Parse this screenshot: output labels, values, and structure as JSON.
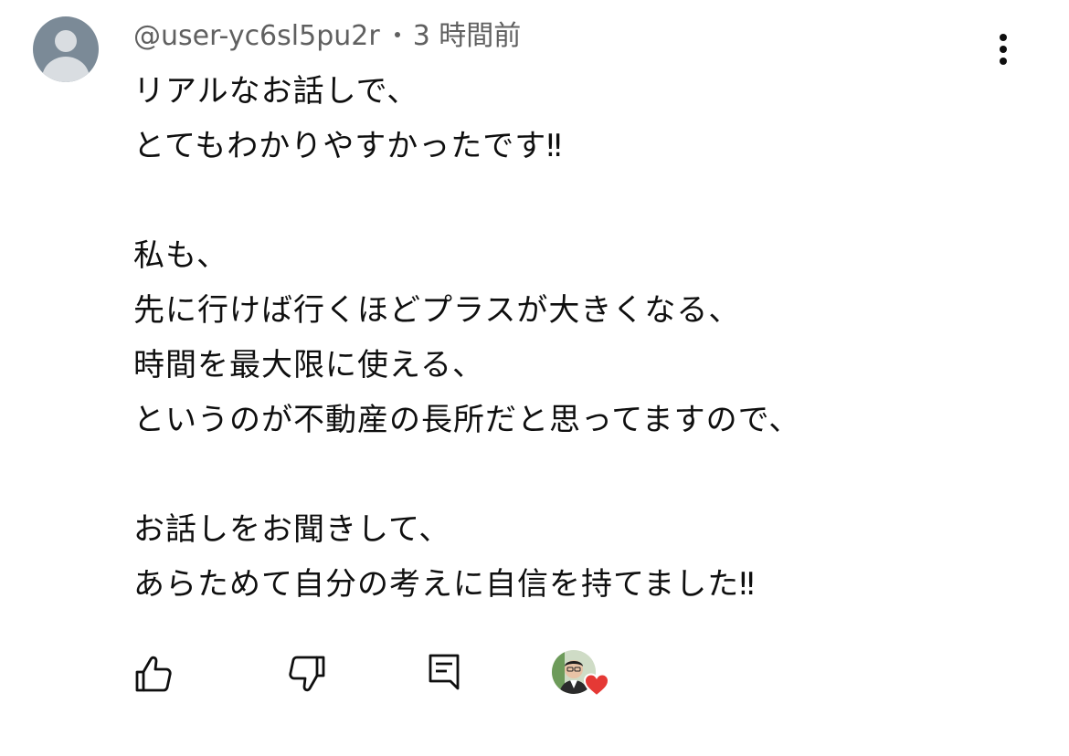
{
  "comment": {
    "author": "@user-yc6sl5pu2r",
    "time": "3 時間前",
    "lines": [
      "リアルなお話しで、",
      "とてもわかりやすかったです‼︎",
      "",
      "私も、",
      "先に行けば行くほどプラスが大きくなる、",
      "時間を最大限に使える、",
      "というのが不動産の長所だと思ってますので、",
      "",
      "お話しをお聞きして、",
      "あらためて自分の考えに自信を持てました‼︎"
    ]
  },
  "icons": {
    "avatar": "default-avatar-icon",
    "menu": "more-vert-icon",
    "like": "thumbs-up-icon",
    "dislike": "thumbs-down-icon",
    "reply": "reply-comment-icon",
    "creator_heart": "creator-heart-badge"
  },
  "colors": {
    "text": "#0f0f0f",
    "meta": "#606060",
    "avatar_bg": "#7b8a97",
    "heart": "#e53935"
  }
}
